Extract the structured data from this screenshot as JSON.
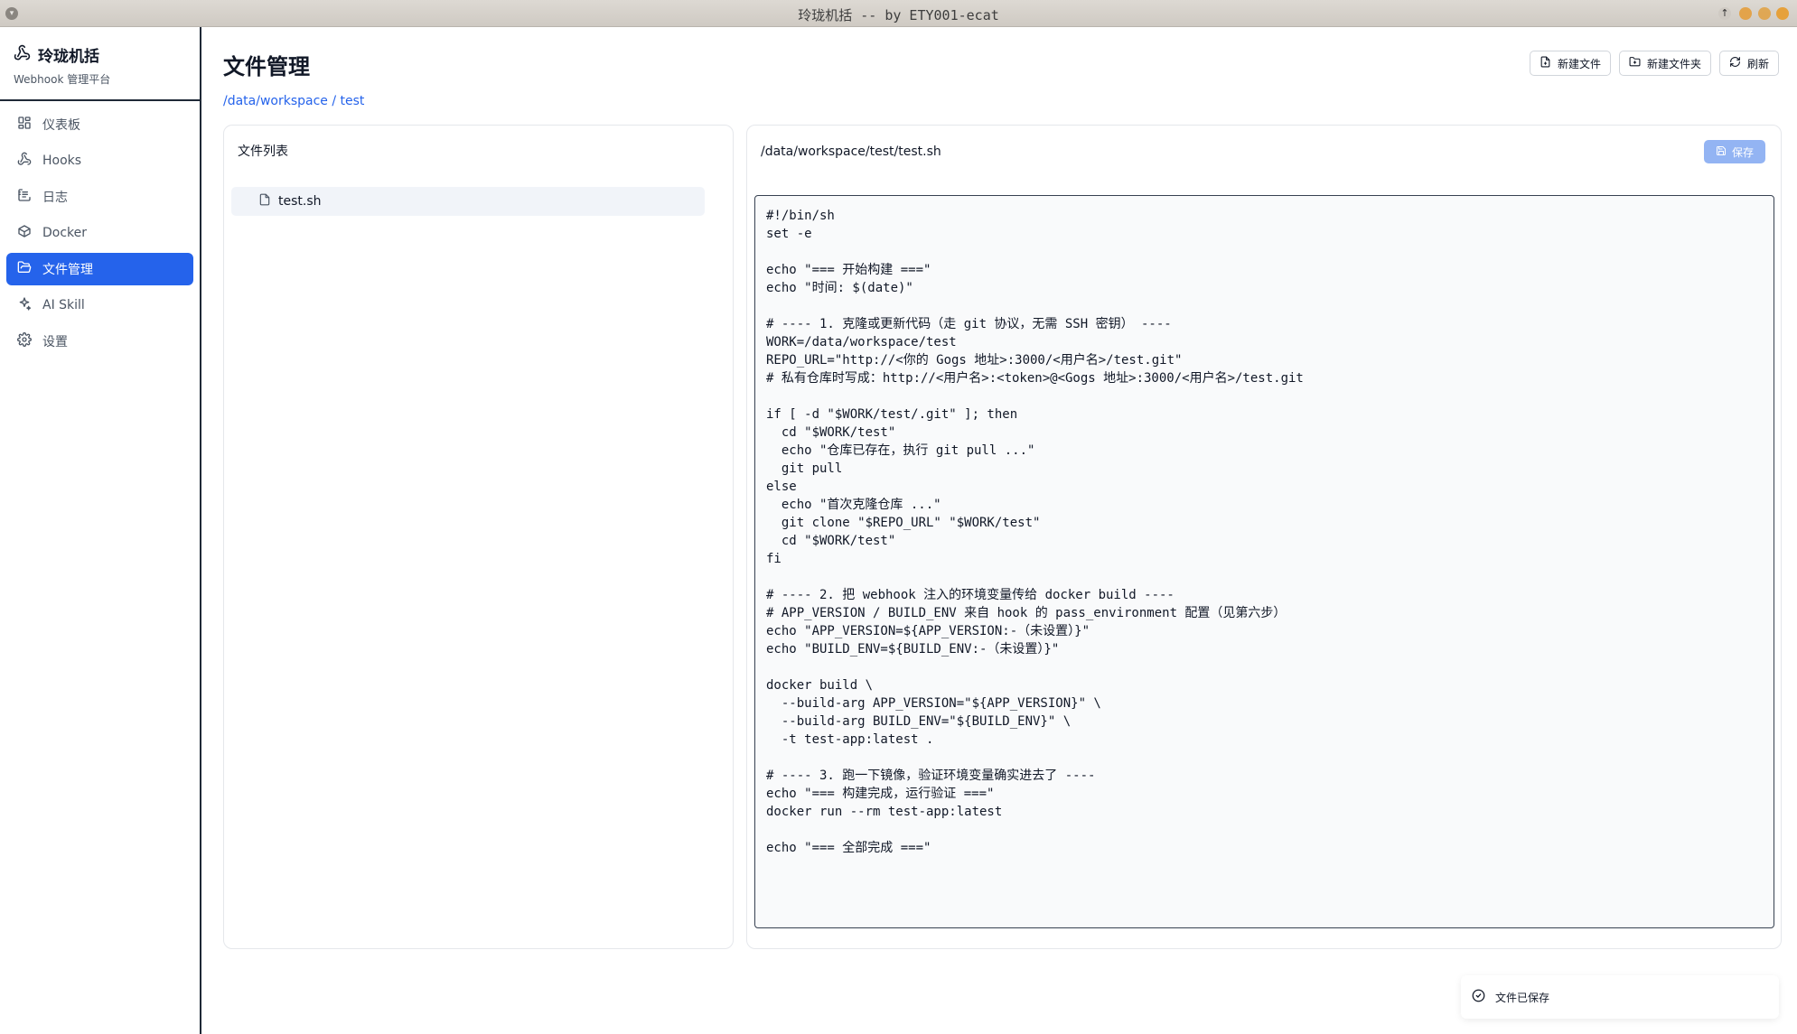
{
  "window": {
    "title": "玲珑机括 -- by ETY001-ecat"
  },
  "brand": {
    "title": "玲珑机括",
    "subtitle": "Webhook 管理平台"
  },
  "nav": {
    "items": [
      {
        "label": "仪表板",
        "icon": "dashboard-icon"
      },
      {
        "label": "Hooks",
        "icon": "webhook-icon"
      },
      {
        "label": "日志",
        "icon": "log-icon"
      },
      {
        "label": "Docker",
        "icon": "container-icon"
      },
      {
        "label": "文件管理",
        "icon": "folder-icon",
        "active": true
      },
      {
        "label": "AI Skill",
        "icon": "sparkles-icon"
      },
      {
        "label": "设置",
        "icon": "gear-icon"
      }
    ]
  },
  "page": {
    "title": "文件管理",
    "breadcrumb": "/data/workspace / test"
  },
  "toolbar": {
    "new_file": "新建文件",
    "new_folder": "新建文件夹",
    "refresh": "刷新"
  },
  "files": {
    "header": "文件列表",
    "items": [
      {
        "name": "test.sh"
      }
    ]
  },
  "editor": {
    "path": "/data/workspace/test/test.sh",
    "save_label": "保存",
    "content": "#!/bin/sh\nset -e\n\necho \"=== 开始构建 ===\"\necho \"时间: $(date)\"\n\n# ---- 1. 克隆或更新代码（走 git 协议，无需 SSH 密钥） ----\nWORK=/data/workspace/test\nREPO_URL=\"http://<你的 Gogs 地址>:3000/<用户名>/test.git\"\n# 私有仓库时写成：http://<用户名>:<token>@<Gogs 地址>:3000/<用户名>/test.git\n\nif [ -d \"$WORK/test/.git\" ]; then\n  cd \"$WORK/test\"\n  echo \"仓库已存在，执行 git pull ...\"\n  git pull\nelse\n  echo \"首次克隆仓库 ...\"\n  git clone \"$REPO_URL\" \"$WORK/test\"\n  cd \"$WORK/test\"\nfi\n\n# ---- 2. 把 webhook 注入的环境变量传给 docker build ----\n# APP_VERSION / BUILD_ENV 来自 hook 的 pass_environment 配置（见第六步）\necho \"APP_VERSION=${APP_VERSION:-（未设置）}\"\necho \"BUILD_ENV=${BUILD_ENV:-（未设置）}\"\n\ndocker build \\\n  --build-arg APP_VERSION=\"${APP_VERSION}\" \\\n  --build-arg BUILD_ENV=\"${BUILD_ENV}\" \\\n  -t test-app:latest .\n\n# ---- 3. 跑一下镜像，验证环境变量确实进去了 ----\necho \"=== 构建完成，运行验证 ===\"\ndocker run --rm test-app:latest\n\necho \"=== 全部完成 ===\""
  },
  "toast": {
    "message": "文件已保存"
  },
  "colors": {
    "accent": "#2563eb",
    "save_disabled": "#93b4f3"
  }
}
